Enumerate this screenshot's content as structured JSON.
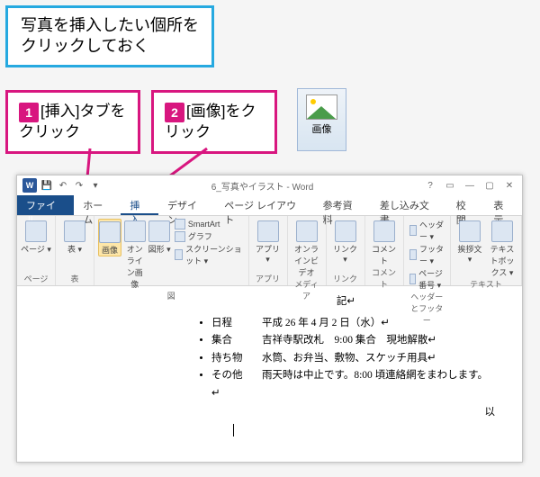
{
  "instruction": "写真を挿入したい個所を\nクリックしておく",
  "steps": {
    "one": {
      "num": "1",
      "before": "[挿入]",
      "after": "タブをクリック"
    },
    "two": {
      "num": "2",
      "before": "[画像]",
      "after": "をクリック"
    }
  },
  "thumb_label": "画像",
  "word": {
    "doc_title": "6_写真やイラスト - Word",
    "tabs": {
      "file": "ファイル",
      "home": "ホーム",
      "insert": "挿入",
      "design": "デザイン",
      "pagelayout": "ページ レイアウト",
      "references": "参考資料",
      "mailings": "差し込み文書",
      "review": "校閲",
      "view": "表示"
    },
    "ribbon": {
      "pages": {
        "label": "ページ",
        "btn": "ページ ▾"
      },
      "tables": {
        "label": "表",
        "btn": "表 ▾"
      },
      "ill": {
        "label": "図",
        "image": "画像",
        "online": "オンライン画像",
        "shapes": "図形 ▾",
        "smartart": "SmartArt",
        "chart": "グラフ",
        "screenshot": "スクリーンショット ▾"
      },
      "apps": {
        "label": "アプリ",
        "btn": "アプリ ▾"
      },
      "media": {
        "label": "メディア",
        "btn": "オンラインビデオ"
      },
      "links": {
        "label": "リンク",
        "btn": "リンク ▾"
      },
      "comments": {
        "label": "コメント",
        "btn": "コメント"
      },
      "hf": {
        "label": "ヘッダーとフッター",
        "header": "ヘッダー ▾",
        "footer": "フッター ▾",
        "pageno": "ページ番号 ▾"
      },
      "text": {
        "label": "テキスト",
        "docparts": "挨拶文 ▾",
        "textbox": "テキストボックス ▾"
      }
    },
    "doc": {
      "heading": "記↵",
      "items": [
        {
          "label": "日程",
          "text": "平成 26 年 4 月 2 日（水）↵"
        },
        {
          "label": "集合",
          "text": "吉祥寺駅改札　9:00 集合　現地解散↵"
        },
        {
          "label": "持ち物",
          "text": "水筒、お弁当、敷物、スケッチ用具↵"
        },
        {
          "label": "その他",
          "text": "雨天時は中止です。8:00 頃連絡網をまわします。↵"
        }
      ],
      "closing": "以"
    }
  }
}
